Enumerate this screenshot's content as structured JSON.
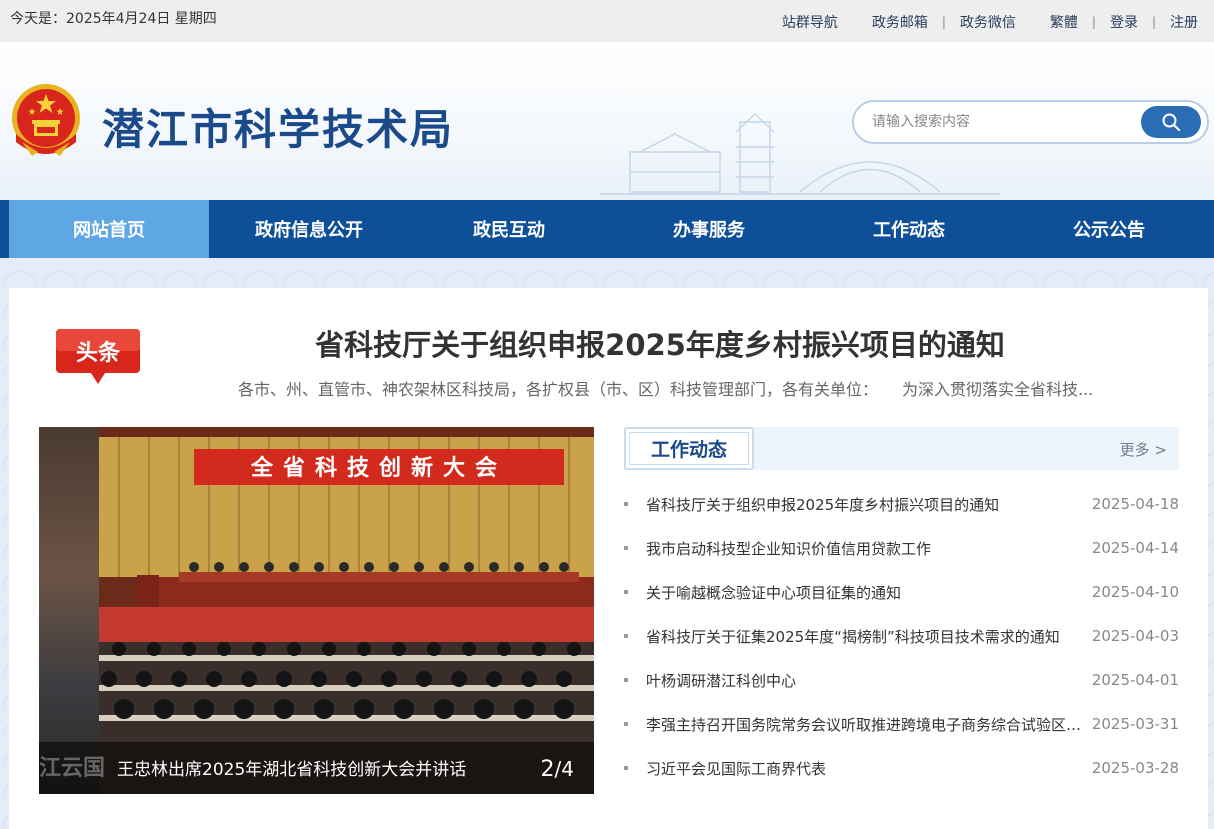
{
  "topbar": {
    "date_text": "今天是：2025年4月24日 星期四",
    "links": [
      "站群导航",
      "政务邮箱",
      "政务微信",
      "繁體",
      "登录",
      "注册"
    ]
  },
  "header": {
    "site_title": "潜江市科学技术局",
    "search_placeholder": "请输入搜索内容"
  },
  "nav": {
    "items": [
      "网站首页",
      "政府信息公开",
      "政民互动",
      "办事服务",
      "工作动态",
      "公示公告"
    ],
    "active_index": 0
  },
  "headline": {
    "badge": "头条",
    "title": "省科技厅关于组织申报2025年度乡村振兴项目的通知",
    "summary": "各市、州、直管市、神农架林区科技局，各扩权县（市、区）科技管理部门，各有关单位：　　为深入贯彻落实全省科技..."
  },
  "carousel": {
    "banner_text": "全省科技创新大会",
    "ghost_text": "江云国",
    "caption": "王忠林出席2025年湖北省科技创新大会并讲话",
    "current": "2",
    "total": "/4"
  },
  "news_panel": {
    "tab_label": "工作动态",
    "more_label": "更多 >",
    "items": [
      {
        "title": "省科技厅关于组织申报2025年度乡村振兴项目的通知",
        "date": "2025-04-18"
      },
      {
        "title": "我市启动科技型企业知识价值信用贷款工作",
        "date": "2025-04-14"
      },
      {
        "title": "关于喻越概念验证中心项目征集的通知",
        "date": "2025-04-10"
      },
      {
        "title": "省科技厅关于征集2025年度“揭榜制”科技项目技术需求的通知",
        "date": "2025-04-03"
      },
      {
        "title": "叶杨调研潜江科创中心",
        "date": "2025-04-01"
      },
      {
        "title": "李强主持召开国务院常务会议听取推进跨境电子商务综合试验区建设情况汇报",
        "date": "2025-03-31"
      },
      {
        "title": "习近平会见国际工商界代表",
        "date": "2025-03-28"
      }
    ]
  },
  "colors": {
    "nav_bg": "#0d4f98",
    "nav_active": "#5fa7e4",
    "title_blue": "#1b4a8a",
    "badge_red": "#d9261c"
  }
}
